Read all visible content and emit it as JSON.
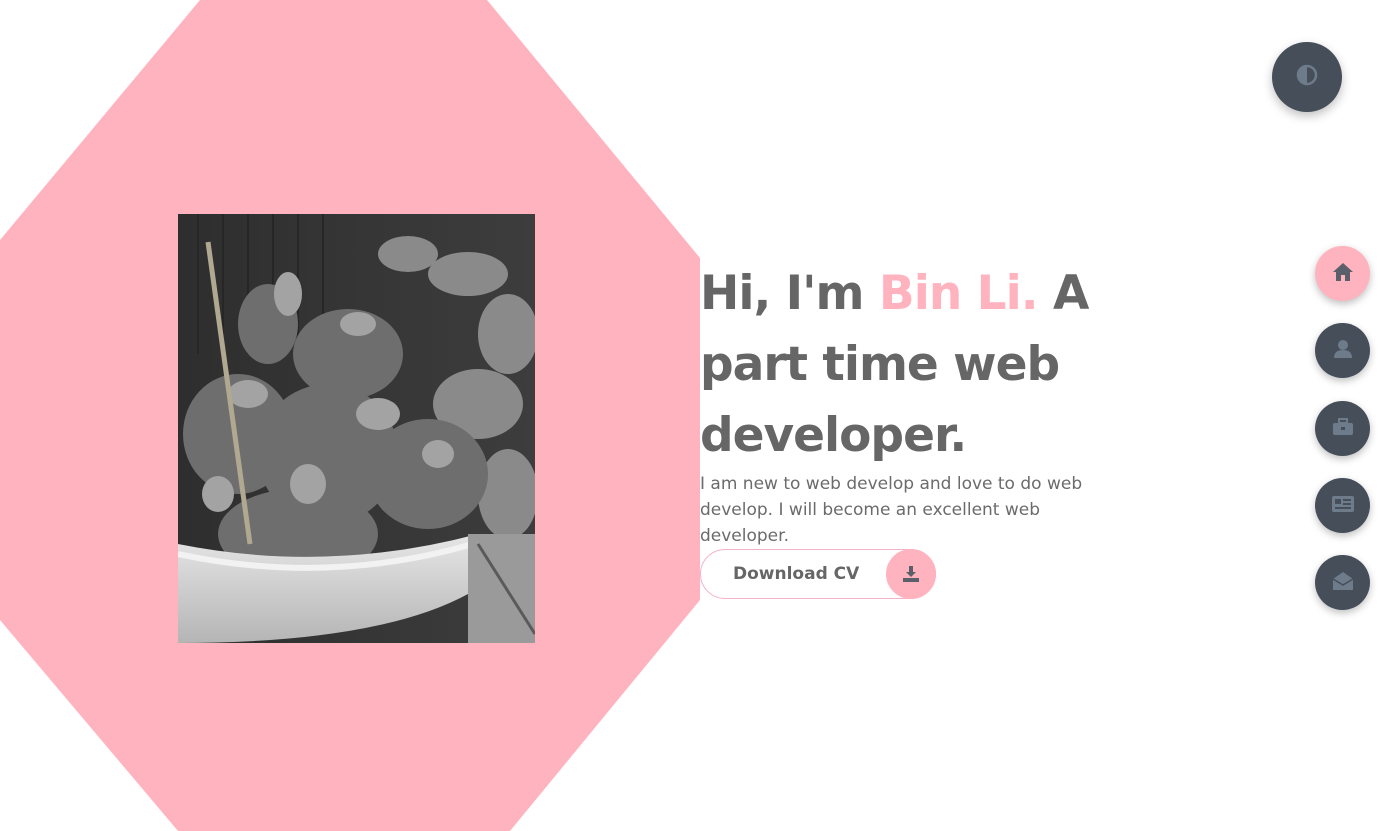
{
  "hero": {
    "greeting": "Hi, I'm",
    "name": "Bin Li.",
    "title_rest": "A part time web developer.",
    "description": "I am new to web develop and love to do web develop. I will become an excellent web developer.",
    "download_label": "Download CV"
  },
  "icons": {
    "theme": "contrast-icon",
    "download": "download-icon",
    "home": "home-icon",
    "about": "user-icon",
    "portfolio": "briefcase-icon",
    "blogs": "newspaper-icon",
    "contact": "envelope-open-icon"
  },
  "navigation": {
    "active": "home"
  },
  "colors": {
    "accent": "#ffb3bf",
    "dark": "#464e5a",
    "text": "#666666",
    "icon": "#6e7b8b"
  }
}
